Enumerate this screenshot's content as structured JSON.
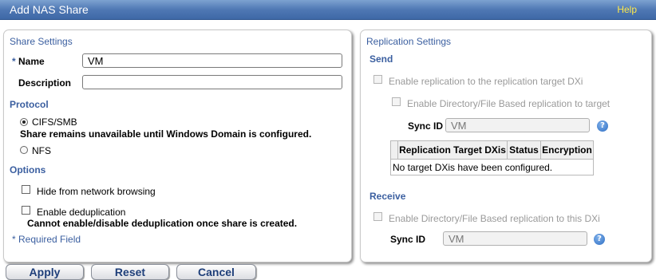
{
  "window": {
    "title": "Add NAS Share",
    "help_label": "Help"
  },
  "share_settings": {
    "panel_title": "Share Settings",
    "name": {
      "required_mark": "*",
      "label": "Name",
      "value": "VM"
    },
    "description": {
      "label": "Description",
      "value": ""
    },
    "protocol": {
      "heading": "Protocol",
      "options": [
        {
          "label": "CIFS/SMB",
          "selected": true,
          "note": "Share remains unavailable until Windows Domain is configured."
        },
        {
          "label": "NFS",
          "selected": false
        }
      ]
    },
    "options": {
      "heading": "Options",
      "hide_browsing": {
        "label": "Hide from network browsing",
        "checked": false
      },
      "dedup": {
        "label": "Enable deduplication",
        "checked": false,
        "note": "Cannot enable/disable deduplication once share is created."
      }
    },
    "required_note": "* Required Field"
  },
  "replication_settings": {
    "panel_title": "Replication Settings",
    "send": {
      "heading": "Send",
      "enable_replication": {
        "label": "Enable replication to the replication target DXi",
        "checked": false,
        "disabled": true
      },
      "enable_dir_file": {
        "label": "Enable Directory/File Based replication to target",
        "checked": false,
        "disabled": true
      },
      "sync_id": {
        "label": "Sync ID",
        "value": "VM"
      },
      "table": {
        "columns": [
          "Replication Target DXis",
          "Status",
          "Encryption"
        ],
        "empty_message": "No target DXis have been configured."
      }
    },
    "receive": {
      "heading": "Receive",
      "enable_dir_file": {
        "label": "Enable Directory/File Based replication to this DXi",
        "checked": false,
        "disabled": true
      },
      "sync_id": {
        "label": "Sync ID",
        "value": "VM"
      }
    }
  },
  "buttons": {
    "apply": "Apply",
    "reset": "Reset",
    "cancel": "Cancel"
  },
  "icons": {
    "help": "help-question-icon"
  },
  "colors": {
    "titlebar": "#4f78b4",
    "heading": "#3b5fa0",
    "help_link": "#ffe94a",
    "button_text": "#1f3f7a"
  }
}
